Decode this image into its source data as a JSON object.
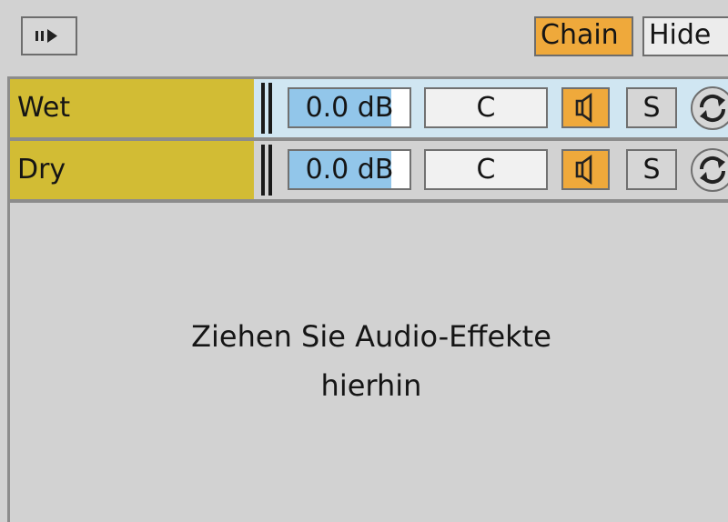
{
  "toolbar": {
    "toggle_icon": "play-arrow-icon",
    "chain_label": "Chain",
    "hide_label": "Hide",
    "chain_color": "#efa93b"
  },
  "chains": [
    {
      "name": "Wet",
      "volume": "0.0 dB",
      "volume_fill": 0.85,
      "pan": "C",
      "speaker_icon": "speaker-icon",
      "solo_label": "S",
      "hotswap_icon": "hot-swap-icon",
      "selected": true
    },
    {
      "name": "Dry",
      "volume": "0.0 dB",
      "volume_fill": 0.85,
      "pan": "C",
      "speaker_icon": "speaker-icon",
      "solo_label": "S",
      "hotswap_icon": "hot-swap-icon",
      "selected": false
    }
  ],
  "drop_area": {
    "line1": "Ziehen Sie Audio-Effekte",
    "line2": "hierhin"
  },
  "colors": {
    "name_cell": "#d2bc34",
    "selected_row": "#d0e6f2",
    "volume_fill": "#92c6ea",
    "active_button": "#efa93b"
  }
}
